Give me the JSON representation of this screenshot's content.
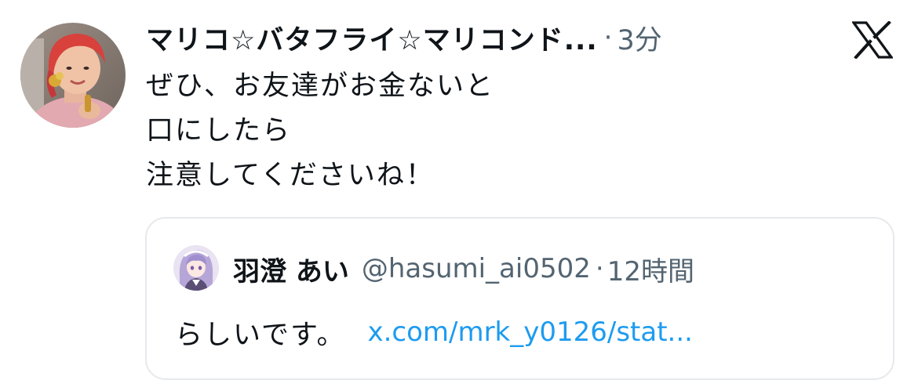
{
  "tweet": {
    "author": {
      "display_name": "マリコ☆バタフライ☆マリコンド...",
      "avatar_icon": "profile-avatar"
    },
    "separator": "·",
    "time": "3分",
    "text_lines": [
      "ぜひ、お友達がお金ないと",
      "口にしたら",
      "注意してくださいね！"
    ],
    "brand_icon": "x-logo-icon"
  },
  "quoted_tweet": {
    "author": {
      "display_name": "羽澄 あい",
      "handle": "@hasumi_ai0502",
      "avatar_icon": "profile-avatar"
    },
    "separator": "·",
    "time": "12時間",
    "text": "らしいです。",
    "link": "x.com/mrk_y0126/stat..."
  },
  "colors": {
    "text_primary": "#0f1419",
    "text_secondary": "#536471",
    "link": "#1d9bf0",
    "border": "#e6e9ec"
  }
}
